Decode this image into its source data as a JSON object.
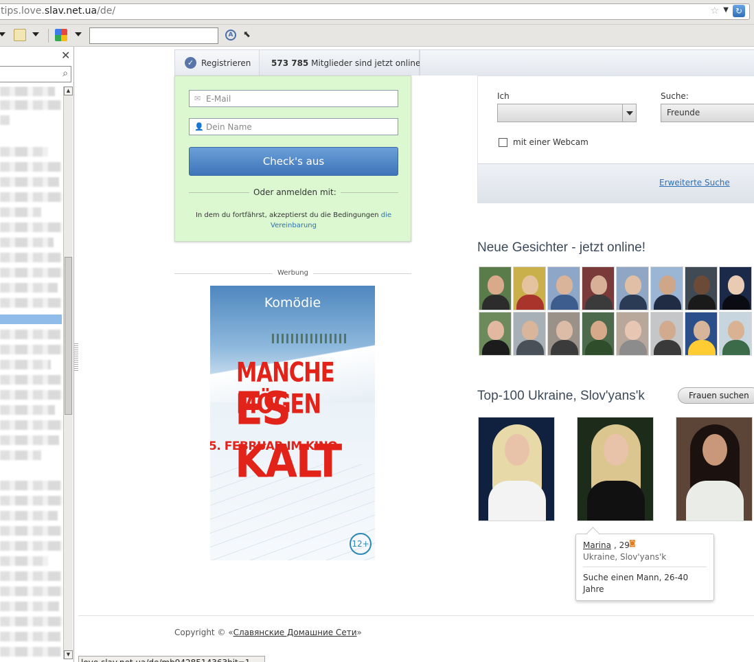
{
  "browser": {
    "url_prefix": "tips.love.",
    "url_host": "slav.net.ua",
    "url_path": "/de/",
    "status_url": "love.slav.net.ua/de/mb9428514363hit=1"
  },
  "header": {
    "register_label": "Registrieren",
    "online_count": "573 785",
    "online_text": "Mitglieder sind jetzt online"
  },
  "register": {
    "email_placeholder": "E-Mail",
    "name_placeholder": "Dein Name",
    "submit_label": "Check's aus",
    "or_label": "Oder anmelden mit:",
    "terms_text": "In dem du fortfährst, akzeptierst du die Bedingungen",
    "terms_link": "die Vereinbarung"
  },
  "ad": {
    "label": "Werbung",
    "tagline": "Komödie",
    "title_line1": "MANCHE MÖGEN",
    "title_line2": "ES KALT",
    "date": "5. FEBRUAR IM KINO",
    "age_rating": "12+"
  },
  "search": {
    "ich_label": "Ich",
    "ich_value": "",
    "suche_label": "Suche:",
    "suche_value": "Freunde",
    "webcam_label": "mit einer Webcam",
    "webcam_checked": false,
    "advanced_link": "Erweiterte Suche"
  },
  "faces": {
    "title": "Neue Gesichter - jetzt online!"
  },
  "top100": {
    "title": "Top-100 Ukraine, Slov'yans'k",
    "button": "Frauen suchen"
  },
  "tooltip": {
    "name": "Marina",
    "age": ", 29",
    "location": "Ukraine, Slov'yans'k",
    "seeking": "Suche einen Mann, 26-40 Jahre"
  },
  "footer": {
    "copyright": "Copyright ©",
    "network_link": "Славянские Домашние Сети"
  },
  "colors": {
    "accent_blue": "#4a7fc0",
    "register_bg": "#dbf8d0",
    "link": "#2c6fb5"
  }
}
